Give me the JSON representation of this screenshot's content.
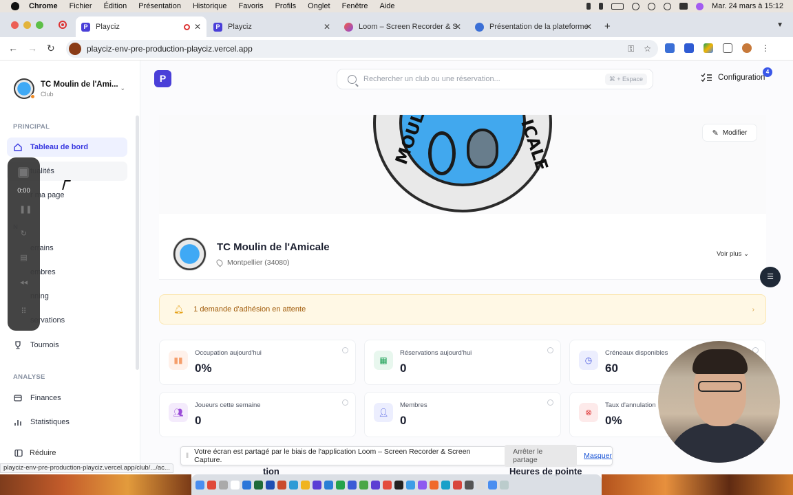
{
  "menubar": {
    "app": "Chrome",
    "items": [
      "Fichier",
      "Édition",
      "Présentation",
      "Historique",
      "Favoris",
      "Profils",
      "Onglet",
      "Fenêtre",
      "Aide"
    ],
    "clock": "Mar. 24 mars à 15:12"
  },
  "tabs": [
    {
      "title": "Playciz",
      "icon": "playciz-favicon",
      "active": true
    },
    {
      "title": "Playciz",
      "icon": "playciz-favicon",
      "active": false
    },
    {
      "title": "Loom – Screen Recorder & S",
      "icon": "loom-favicon",
      "active": false
    },
    {
      "title": "Présentation de la plateforme",
      "icon": "globe-favicon",
      "active": false
    }
  ],
  "address": {
    "url": "playciz-env-pre-production-playciz.vercel.app"
  },
  "sidebar": {
    "club_name": "TC Moulin de l'Ami...",
    "club_type": "Club",
    "section_principal": "PRINCIPAL",
    "section_analyse": "ANALYSE",
    "principal_items": [
      {
        "label": "Tableau de bord",
        "icon": "home-icon"
      },
      {
        "label": "tualités",
        "icon": "news-icon"
      },
      {
        "label": "r ma page",
        "icon": "page-icon"
      }
    ],
    "partial_section": "N",
    "gestion_items": [
      {
        "label": "errains",
        "icon": "court-icon"
      },
      {
        "label": "embres",
        "icon": "users-icon"
      },
      {
        "label": "nning",
        "icon": "calendar-icon"
      },
      {
        "label": "servations",
        "icon": "booking-icon"
      },
      {
        "label": "Tournois",
        "icon": "trophy-icon"
      }
    ],
    "analyse_items": [
      {
        "label": "Finances",
        "icon": "finance-icon"
      },
      {
        "label": "Statistiques",
        "icon": "stats-icon"
      }
    ],
    "reduce_label": "Réduire"
  },
  "loom": {
    "timer": "0:00"
  },
  "header": {
    "logo_letter": "P",
    "search_placeholder": "Rechercher un club ou une réservation...",
    "search_shortcut": "⌘ + Espace",
    "config_label": "Configuration",
    "config_badge": "4"
  },
  "cover": {
    "edit_label": "Modifier",
    "logo_words": [
      "MOUL",
      "ICALE"
    ]
  },
  "club": {
    "name": "TC Moulin de l'Amicale",
    "location": "Montpellier (34080)",
    "more_label": "Voir plus"
  },
  "alert": {
    "text": "1 demande d'adhésion en attente"
  },
  "stats": [
    {
      "label": "Occupation aujourd'hui",
      "value": "0%",
      "icon": "chart-icon",
      "color": "#f59e6b",
      "bg": "#fff1ea"
    },
    {
      "label": "Réservations aujourd'hui",
      "value": "0",
      "icon": "calendar-icon",
      "color": "#22a35a",
      "bg": "#e8f7ee"
    },
    {
      "label": "Créneaux disponibles",
      "value": "60",
      "icon": "clock-icon",
      "color": "#4a5be0",
      "bg": "#eceefe"
    },
    {
      "label": "Joueurs cette semaine",
      "value": "0",
      "icon": "players-icon",
      "color": "#9b4dd8",
      "bg": "#f4ebfc"
    },
    {
      "label": "Membres",
      "value": "0",
      "icon": "member-icon",
      "color": "#4a5be0",
      "bg": "#eceefe"
    },
    {
      "label": "Taux d'annulation",
      "value": "0%",
      "icon": "cancel-icon",
      "color": "#e03a3a",
      "bg": "#fdeaea"
    }
  ],
  "share": {
    "message": "Votre écran est partagé par le biais de l'application Loom – Screen Recorder & Screen Capture.",
    "stop_label": "Arrêter le partage",
    "hide_label": "Masquer"
  },
  "peek": {
    "left": "tion",
    "right": "Heures de pointe"
  },
  "status_url": "playciz-env-pre-production-playciz.vercel.app/club/.../ac..."
}
